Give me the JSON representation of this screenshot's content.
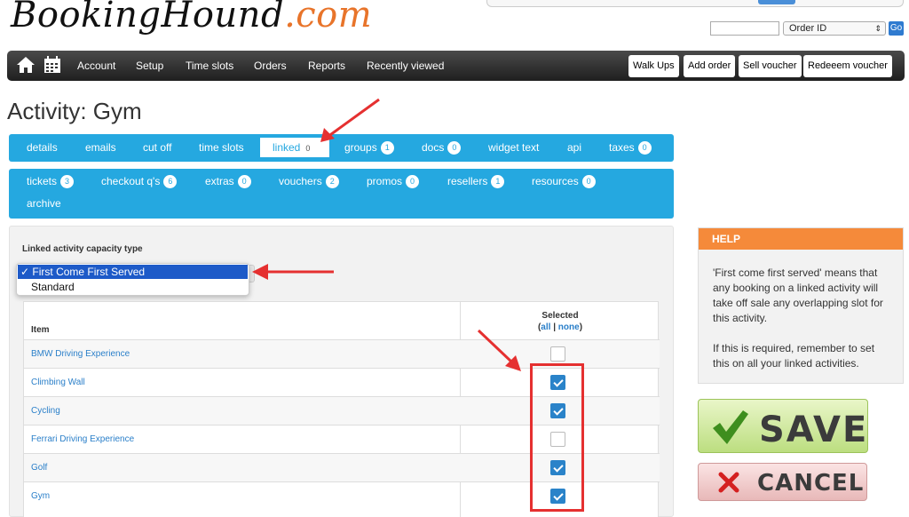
{
  "header": {
    "logo_main": "BookingHound",
    "logo_suffix": ".com",
    "order_input_value": "",
    "order_select_value": "Order ID",
    "go_label": "Go"
  },
  "nav": {
    "items": [
      "Account",
      "Setup",
      "Time slots",
      "Orders",
      "Reports",
      "Recently viewed"
    ],
    "buttons": [
      "Walk Ups",
      "Add order",
      "Sell voucher",
      "Redeeem voucher"
    ]
  },
  "page_title": "Activity: Gym",
  "tabs_row1": [
    {
      "label": "details"
    },
    {
      "label": "emails"
    },
    {
      "label": "cut off"
    },
    {
      "label": "time slots"
    },
    {
      "label": "linked",
      "count": "0"
    },
    {
      "label": "groups",
      "count": "1"
    },
    {
      "label": "docs",
      "count": "0"
    },
    {
      "label": "widget text"
    },
    {
      "label": "api"
    },
    {
      "label": "taxes",
      "count": "0"
    }
  ],
  "tabs_row2": [
    {
      "label": "tickets",
      "count": "3"
    },
    {
      "label": "checkout q's",
      "count": "6"
    },
    {
      "label": "extras",
      "count": "0"
    },
    {
      "label": "vouchers",
      "count": "2"
    },
    {
      "label": "promos",
      "count": "0"
    },
    {
      "label": "resellers",
      "count": "1"
    },
    {
      "label": "resources",
      "count": "0"
    },
    {
      "label": "archive"
    }
  ],
  "capacity": {
    "label": "Linked activity capacity type",
    "options": [
      "First Come First Served",
      "Standard"
    ],
    "selected_prefix": "✓"
  },
  "table": {
    "col_item": "Item",
    "col_selected": "Selected",
    "link_all": "all",
    "link_none": "none",
    "sep": "|",
    "paren_open": "(",
    "paren_close": ")",
    "rows": [
      {
        "name": "BMW Driving Experience",
        "checked": false
      },
      {
        "name": "Climbing Wall",
        "checked": true
      },
      {
        "name": "Cycling",
        "checked": true
      },
      {
        "name": "Ferrari Driving Experience",
        "checked": false
      },
      {
        "name": "Golf",
        "checked": true
      },
      {
        "name": "Gym",
        "checked": true
      }
    ]
  },
  "help": {
    "title": "HELP",
    "p1": "'First come first served' means that any booking on a linked activity will take off sale any overlapping slot for this activity.",
    "p2": "If this is required, remember to set this on all your linked activities."
  },
  "actions": {
    "save": "SAVE",
    "cancel": "CANCEL"
  },
  "colors": {
    "accent": "#25a8e0",
    "help_header": "#f58a3a",
    "annotation": "#e53030",
    "checkbox": "#2a83c9"
  }
}
